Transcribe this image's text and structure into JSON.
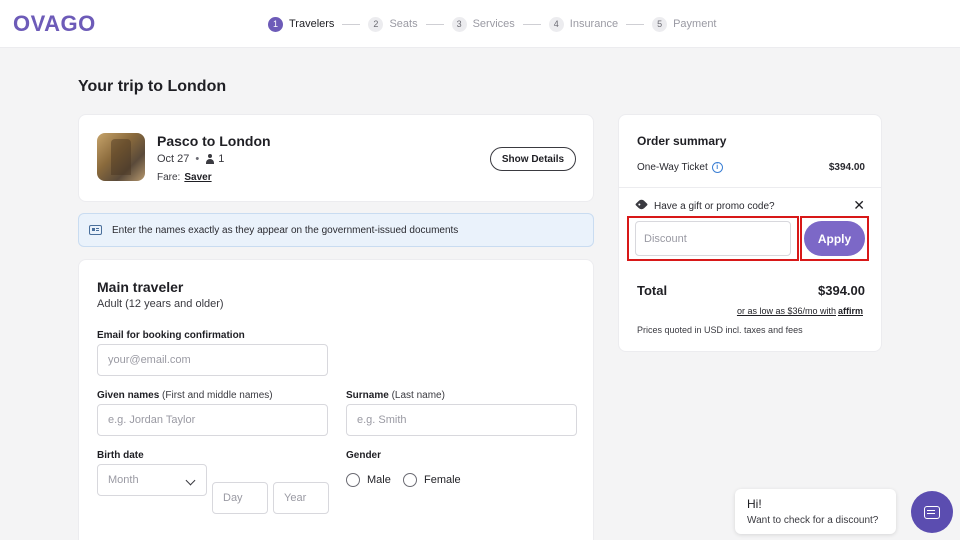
{
  "header": {
    "logo": "OVAGO",
    "steps": [
      {
        "num": "1",
        "label": "Travelers",
        "active": true
      },
      {
        "num": "2",
        "label": "Seats"
      },
      {
        "num": "3",
        "label": "Services"
      },
      {
        "num": "4",
        "label": "Insurance"
      },
      {
        "num": "5",
        "label": "Payment"
      }
    ]
  },
  "trip": {
    "title": "Your trip to London",
    "route": "Pasco to London",
    "date": "Oct 27",
    "separator": "•",
    "passengers": "1",
    "fare_label": "Fare:",
    "fare_value": "Saver",
    "details_button": "Show Details"
  },
  "notice": "Enter the names exactly as they appear on the government-issued documents",
  "traveler": {
    "title": "Main traveler",
    "subtitle": "Adult (12 years and older)",
    "email_label": "Email for booking confirmation",
    "email_placeholder": "your@email.com",
    "given_label": "Given names",
    "given_hint": "(First and middle names)",
    "given_placeholder": "e.g. Jordan Taylor",
    "surname_label": "Surname",
    "surname_hint": "(Last name)",
    "surname_placeholder": "e.g. Smith",
    "birth_label": "Birth date",
    "month_placeholder": "Month",
    "day_placeholder": "Day",
    "year_placeholder": "Year",
    "gender_label": "Gender",
    "gender_male": "Male",
    "gender_female": "Female"
  },
  "summary": {
    "title": "Order summary",
    "ticket_label": "One-Way Ticket",
    "ticket_price": "$394.00",
    "promo_label": "Have a gift or promo code?",
    "close": "✕",
    "discount_placeholder": "Discount",
    "apply": "Apply",
    "total_label": "Total",
    "total_price": "$394.00",
    "affirm_text": "or as low as $36/mo with",
    "affirm_brand": "affirm",
    "note": "Prices quoted in USD incl. taxes and fees"
  },
  "chat": {
    "greeting": "Hi!",
    "question": "Want to check for a discount?"
  },
  "colors": {
    "accent": "#6d5bb8",
    "apply": "#7c68c7",
    "highlight": "#d81818"
  }
}
